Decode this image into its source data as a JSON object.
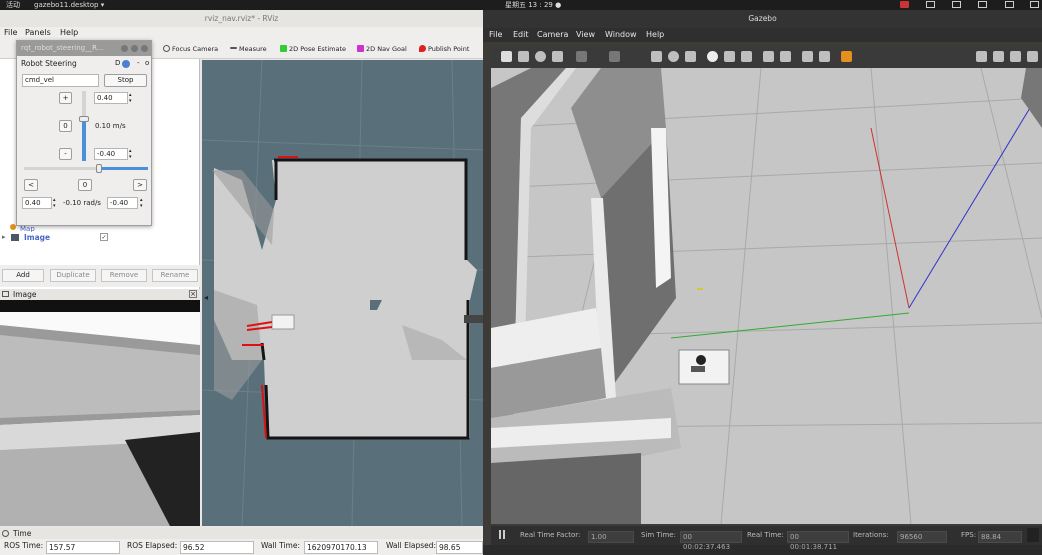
{
  "system": {
    "activities": "活动",
    "app": "gazebo11.desktop",
    "clock": "星期五 13 : 29 ●"
  },
  "rviz": {
    "window_title": "rviz_nav.rviz* - RViz",
    "menu": [
      "File",
      "Panels",
      "Help"
    ],
    "toolbar": {
      "focus_camera": "Focus Camera",
      "measure": "Measure",
      "pose_estimate": "2D Pose Estimate",
      "nav_goal": "2D Nav Goal",
      "publish_point": "Publish Point"
    },
    "displays": {
      "items": [
        "Map",
        "Image"
      ],
      "image_checked": "✓"
    },
    "buttons": {
      "add": "Add",
      "duplicate": "Duplicate",
      "remove": "Remove",
      "rename": "Rename"
    },
    "image_panel_title": "Image",
    "time_panel_title": "Time",
    "time": {
      "ros_time_label": "ROS Time:",
      "ros_time": "157.57",
      "ros_elapsed_label": "ROS Elapsed:",
      "ros_elapsed": "96.52",
      "wall_time_label": "Wall Time:",
      "wall_time": "1620970170.13",
      "wall_elapsed_label": "Wall Elapsed:",
      "wall_elapsed": "98.65"
    }
  },
  "steering": {
    "window_title": "rqt_robot_steering__R...",
    "plugin_title": "Robot Steering",
    "plugin_controls": "D",
    "topic": "cmd_vel",
    "stop": "Stop",
    "plus": "+",
    "minus": "-",
    "zero": "0",
    "lin_max": "0.40",
    "lin_value": "0.10 m/s",
    "lin_min": "-0.40",
    "left": "<",
    "right": ">",
    "ang_center": "0",
    "ang_max": "0.40",
    "ang_value": "-0.10 rad/s",
    "ang_min": "-0.40"
  },
  "gazebo": {
    "window_title": "Gazebo",
    "menu": [
      "File",
      "Edit",
      "Camera",
      "View",
      "Window",
      "Help"
    ],
    "status": {
      "rtf_label": "Real Time Factor:",
      "rtf": "1.00",
      "sim_label": "Sim Time:",
      "sim": "00 00:02:37.463",
      "real_label": "Real Time:",
      "real": "00 00:01:38.711",
      "iter_label": "Iterations:",
      "iter": "96560",
      "fps_label": "FPS:",
      "fps": "88.84"
    }
  },
  "colors": {
    "map_bg": "#59707a",
    "free_space": "#cfcfcf",
    "obstacle": "#111111",
    "gazebo_floor": "#c8c8c8"
  }
}
